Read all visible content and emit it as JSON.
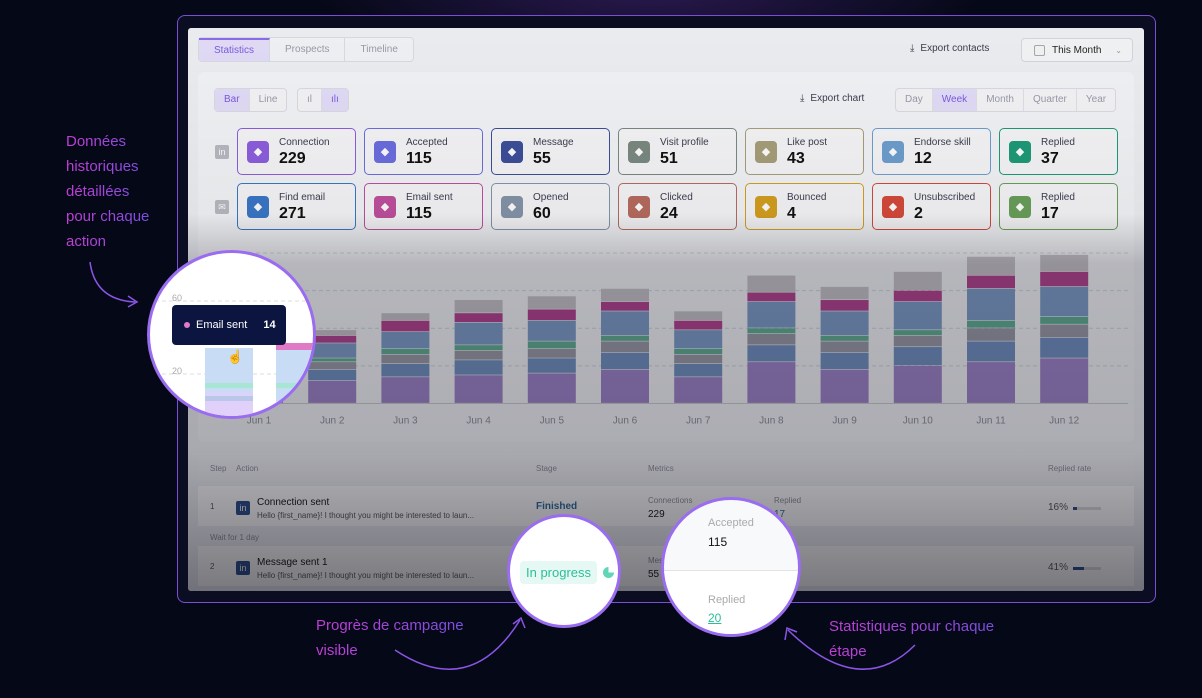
{
  "tabs": [
    {
      "label": "Statistics",
      "active": true
    },
    {
      "label": "Prospects"
    },
    {
      "label": "Timeline"
    }
  ],
  "header": {
    "export_contacts": "Export contacts",
    "period": "This Month"
  },
  "chart_controls": {
    "bar": "Bar",
    "line": "Line",
    "export_chart": "Export chart",
    "ranges": [
      "Day",
      "Week",
      "Month",
      "Quarter",
      "Year"
    ],
    "active_range": "Week"
  },
  "linkedin_stats": [
    {
      "label": "Connection",
      "value": "229",
      "color": "#8e5ee0",
      "icon": "user-plus-icon"
    },
    {
      "label": "Accepted",
      "value": "115",
      "color": "#6c6ee0",
      "icon": "check-circle-icon"
    },
    {
      "label": "Message",
      "value": "55",
      "color": "#3d4f9a",
      "icon": "send-icon"
    },
    {
      "label": "Visit profile",
      "value": "51",
      "color": "#7b8a82",
      "icon": "eye-icon"
    },
    {
      "label": "Like post",
      "value": "43",
      "color": "#a8a07a",
      "icon": "thumbs-up-icon"
    },
    {
      "label": "Endorse skill",
      "value": "12",
      "color": "#6f9fd0",
      "icon": "badge-icon"
    },
    {
      "label": "Replied",
      "value": "37",
      "color": "#1e9b78",
      "icon": "reply-icon"
    }
  ],
  "email_stats": [
    {
      "label": "Find email",
      "value": "271",
      "color": "#3a78c8",
      "icon": "search-icon"
    },
    {
      "label": "Email sent",
      "value": "115",
      "color": "#c0509e",
      "icon": "send-icon"
    },
    {
      "label": "Opened",
      "value": "60",
      "color": "#8595aa",
      "icon": "envelope-open-icon"
    },
    {
      "label": "Clicked",
      "value": "24",
      "color": "#b86c5f",
      "icon": "cursor-click-icon"
    },
    {
      "label": "Bounced",
      "value": "4",
      "color": "#d6a020",
      "icon": "bounce-icon"
    },
    {
      "label": "Unsubscribed",
      "value": "2",
      "color": "#d64a3c",
      "icon": "alert-icon"
    },
    {
      "label": "Replied",
      "value": "17",
      "color": "#6aa05a",
      "icon": "reply-icon"
    }
  ],
  "chart_data": {
    "type": "bar",
    "stacked": true,
    "categories": [
      "Jun 1",
      "Jun 2",
      "Jun 3",
      "Jun 4",
      "Jun 5",
      "Jun 6",
      "Jun 7",
      "Jun 8",
      "Jun 9",
      "Jun 10",
      "Jun 11",
      "Jun 12"
    ],
    "ylim": [
      0,
      80
    ],
    "yticks": [
      20,
      60
    ],
    "grid": true,
    "series": [
      {
        "color": "#9d82c9",
        "values": [
          12,
          12,
          14,
          15,
          16,
          18,
          14,
          22,
          18,
          20,
          22,
          24
        ]
      },
      {
        "color": "#6f8fc0",
        "values": [
          6,
          6,
          7,
          8,
          8,
          9,
          7,
          9,
          9,
          10,
          11,
          11
        ]
      },
      {
        "color": "#9a9aa8",
        "values": [
          4,
          4,
          5,
          5,
          5,
          6,
          5,
          6,
          6,
          6,
          7,
          7
        ]
      },
      {
        "color": "#5fae92",
        "values": [
          2,
          2,
          3,
          3,
          4,
          3,
          3,
          3,
          3,
          3,
          4,
          4
        ]
      },
      {
        "color": "#7d9cc8",
        "values": [
          8,
          8,
          9,
          12,
          11,
          13,
          10,
          14,
          13,
          15,
          17,
          16
        ]
      },
      {
        "color": "#b2408e",
        "values": [
          5,
          4,
          6,
          5,
          6,
          5,
          5,
          5,
          6,
          6,
          7,
          8
        ]
      },
      {
        "color": "#c6c3c8",
        "values": [
          3,
          3,
          4,
          7,
          7,
          7,
          5,
          9,
          7,
          10,
          10,
          9
        ]
      }
    ],
    "tooltip": {
      "label": "Email sent",
      "value": "14"
    }
  },
  "table": {
    "headers": [
      "Step",
      "Action",
      "Stage",
      "Metrics",
      "Replied rate"
    ],
    "rows": [
      {
        "step": "1",
        "title": "Connection sent",
        "sub": "Hello {first_name}! I thought you might be interested to laun...",
        "stage": "Finished",
        "m1_label": "Connections",
        "m1_value": "229",
        "m2_label": "Replied",
        "m2_value": "17",
        "rate": "16%"
      },
      {
        "step": "2",
        "title": "Message sent 1",
        "sub": "Hello {first_name}! I thought you might be interested to laun...",
        "stage": "In progress",
        "m1_label": "Messages",
        "m1_value": "55",
        "rate": "41%"
      }
    ],
    "wait": "Wait for 1 day"
  },
  "zoom_stats": {
    "accepted_label": "Accepted",
    "accepted_value": "115",
    "replied_label": "Replied",
    "replied_value": "20"
  },
  "annotations": {
    "left": [
      "Données",
      "historiques",
      "détaillées",
      "pour chaque",
      "action"
    ],
    "progress": [
      "Progrès de campagne",
      "visible"
    ],
    "stats": [
      "Statistiques pour chaque",
      "étape"
    ]
  }
}
